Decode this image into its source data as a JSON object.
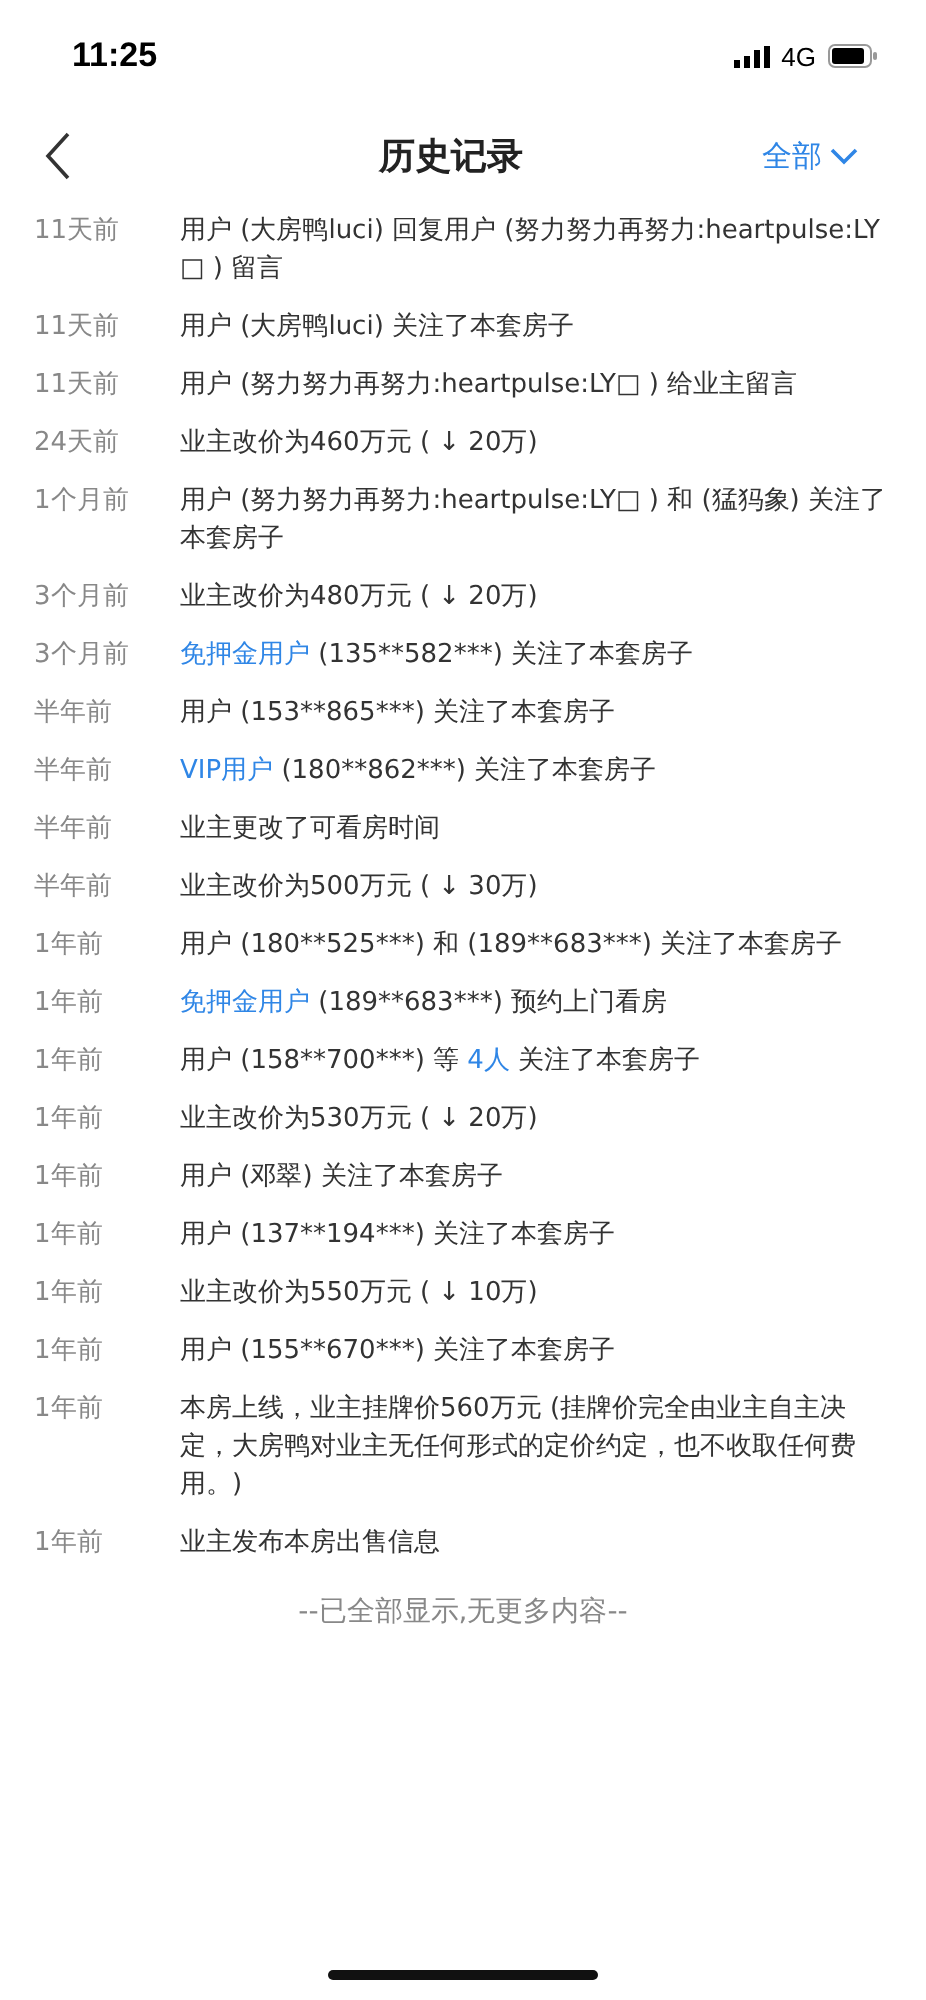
{
  "status_bar": {
    "time": "11:25",
    "network": "4G"
  },
  "nav": {
    "title": "历史记录",
    "filter": "全部"
  },
  "records": [
    {
      "time": "11天前",
      "segments": [
        {
          "text": "用户 (大房鸭luci) 回复用户 (努力努力再努力:heartpulse:LY□ ) 留言",
          "highlight": false
        }
      ]
    },
    {
      "time": "11天前",
      "segments": [
        {
          "text": "用户 (大房鸭luci) 关注了本套房子",
          "highlight": false
        }
      ]
    },
    {
      "time": "11天前",
      "segments": [
        {
          "text": "用户 (努力努力再努力:heartpulse:LY□ ) 给业主留言",
          "highlight": false
        }
      ]
    },
    {
      "time": "24天前",
      "segments": [
        {
          "text": "业主改价为460万元 ( ↓ 20万)",
          "highlight": false
        }
      ]
    },
    {
      "time": "1个月前",
      "segments": [
        {
          "text": "用户 (努力努力再努力:heartpulse:LY□ ) 和 (猛犸象) 关注了本套房子",
          "highlight": false
        }
      ]
    },
    {
      "time": "3个月前",
      "segments": [
        {
          "text": "业主改价为480万元 ( ↓ 20万)",
          "highlight": false
        }
      ]
    },
    {
      "time": "3个月前",
      "segments": [
        {
          "text": "免押金用户",
          "highlight": true
        },
        {
          "text": " (135**582***) 关注了本套房子",
          "highlight": false
        }
      ]
    },
    {
      "time": "半年前",
      "segments": [
        {
          "text": "用户 (153**865***) 关注了本套房子",
          "highlight": false
        }
      ]
    },
    {
      "time": "半年前",
      "segments": [
        {
          "text": "VIP用户",
          "highlight": true
        },
        {
          "text": " (180**862***) 关注了本套房子",
          "highlight": false
        }
      ]
    },
    {
      "time": "半年前",
      "segments": [
        {
          "text": "业主更改了可看房时间",
          "highlight": false
        }
      ]
    },
    {
      "time": "半年前",
      "segments": [
        {
          "text": "业主改价为500万元 ( ↓ 30万)",
          "highlight": false
        }
      ]
    },
    {
      "time": "1年前",
      "segments": [
        {
          "text": "用户 (180**525***) 和 (189**683***) 关注了本套房子",
          "highlight": false
        }
      ]
    },
    {
      "time": "1年前",
      "segments": [
        {
          "text": "免押金用户",
          "highlight": true
        },
        {
          "text": " (189**683***) 预约上门看房",
          "highlight": false
        }
      ]
    },
    {
      "time": "1年前",
      "segments": [
        {
          "text": "用户 (158**700***) 等 ",
          "highlight": false
        },
        {
          "text": "4人",
          "highlight": true
        },
        {
          "text": " 关注了本套房子",
          "highlight": false
        }
      ]
    },
    {
      "time": "1年前",
      "segments": [
        {
          "text": "业主改价为530万元 ( ↓ 20万)",
          "highlight": false
        }
      ]
    },
    {
      "time": "1年前",
      "segments": [
        {
          "text": "用户 (邓翠) 关注了本套房子",
          "highlight": false
        }
      ]
    },
    {
      "time": "1年前",
      "segments": [
        {
          "text": "用户 (137**194***) 关注了本套房子",
          "highlight": false
        }
      ]
    },
    {
      "time": "1年前",
      "segments": [
        {
          "text": "业主改价为550万元 ( ↓ 10万)",
          "highlight": false
        }
      ]
    },
    {
      "time": "1年前",
      "segments": [
        {
          "text": "用户 (155**670***) 关注了本套房子",
          "highlight": false
        }
      ]
    },
    {
      "time": "1年前",
      "segments": [
        {
          "text": "本房上线，业主挂牌价560万元 (挂牌价完全由业主自主决定，大房鸭对业主无任何形式的定价约定，也不收取任何费用。)",
          "highlight": false
        }
      ]
    },
    {
      "time": "1年前",
      "segments": [
        {
          "text": "业主发布本房出售信息",
          "highlight": false
        }
      ]
    }
  ],
  "footer": "--已全部显示,无更多内容--"
}
